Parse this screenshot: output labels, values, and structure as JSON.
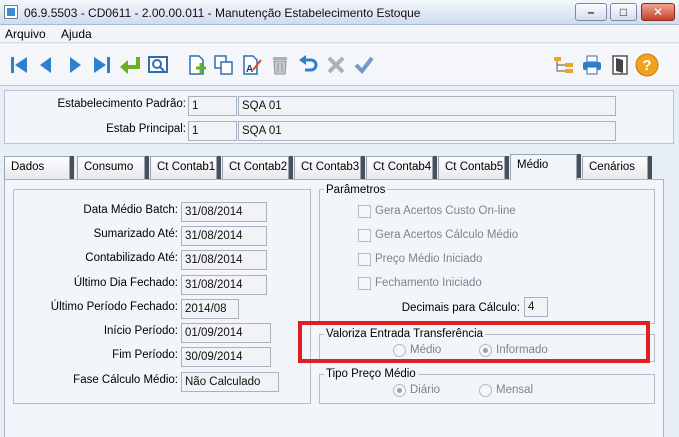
{
  "window": {
    "title": "06.9.5503 - CD0611 - 2.00.00.011 - Manutenção Estabelecimento Estoque"
  },
  "menu": {
    "file": "Arquivo",
    "help": "Ajuda"
  },
  "toolbar": {
    "icons": [
      "first-record-icon",
      "previous-record-icon",
      "next-record-icon",
      "last-record-icon",
      "goto-icon",
      "search-icon",
      "new-record-icon",
      "copy-icon",
      "edit-icon",
      "delete-icon",
      "undo-icon",
      "cancel-icon",
      "confirm-icon",
      "hierarchy-icon",
      "print-icon",
      "exit-icon",
      "help-icon"
    ]
  },
  "header": {
    "estab_padrao_label": "Estabelecimento Padrão:",
    "estab_padrao_code": "1",
    "estab_padrao_name": "SQA 01",
    "estab_principal_label": "Estab Principal:",
    "estab_principal_code": "1",
    "estab_principal_name": "SQA 01"
  },
  "tabs": [
    "Dados",
    "Consumo",
    "Ct Contab1",
    "Ct Contab2",
    "Ct Contab3",
    "Ct Contab4",
    "Ct Contab5",
    "Médio",
    "Cenários"
  ],
  "active_tab": "Médio",
  "medio": {
    "fields": [
      {
        "label": "Data Médio Batch:",
        "value": "31/08/2014"
      },
      {
        "label": "Sumarizado Até:",
        "value": "31/08/2014"
      },
      {
        "label": "Contabilizado Até:",
        "value": "31/08/2014"
      },
      {
        "label": "Último Dia Fechado:",
        "value": "31/08/2014"
      },
      {
        "label": "Último Período Fechado:",
        "value": "2014/08"
      },
      {
        "label": "Início Período:",
        "value": "01/09/2014"
      },
      {
        "label": "Fim Período:",
        "value": "30/09/2014"
      },
      {
        "label": "Fase Cálculo Médio:",
        "value": "Não Calculado"
      }
    ],
    "parametros": {
      "title": "Parâmetros",
      "checks": [
        {
          "label": "Gera Acertos Custo On-line",
          "checked": false
        },
        {
          "label": "Gera Acertos Cálculo Médio",
          "checked": false
        },
        {
          "label": "Preço Médio Iniciado",
          "checked": false
        },
        {
          "label": "Fechamento Iniciado",
          "checked": false
        }
      ],
      "decimais_label": "Decimais para Cálculo:",
      "decimais_value": "4"
    },
    "valoriza": {
      "title": "Valoriza Entrada Transferência",
      "option1": "Médio",
      "option2": "Informado",
      "selected": "Informado"
    },
    "tipo": {
      "title": "Tipo Preço Médio",
      "option1": "Diário",
      "option2": "Mensal",
      "selected": "Diário"
    }
  },
  "colors": {
    "highlight": "#e02020",
    "accent": "#2f7fd0"
  }
}
